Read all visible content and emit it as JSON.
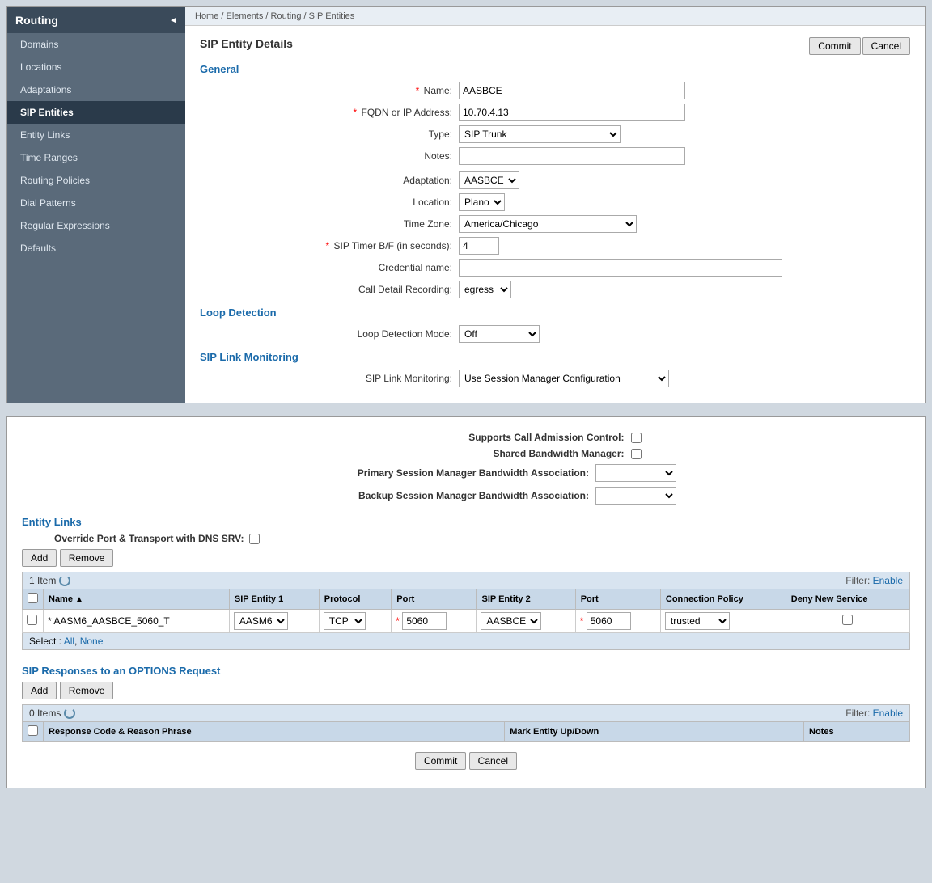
{
  "app": {
    "title": "Routing"
  },
  "breadcrumb": {
    "text": "Home / Elements / Routing / SIP Entities"
  },
  "sidebar": {
    "title": "Routing",
    "items": [
      {
        "label": "Domains",
        "active": false
      },
      {
        "label": "Locations",
        "active": false
      },
      {
        "label": "Adaptations",
        "active": false
      },
      {
        "label": "SIP Entities",
        "active": true
      },
      {
        "label": "Entity Links",
        "active": false
      },
      {
        "label": "Time Ranges",
        "active": false
      },
      {
        "label": "Routing Policies",
        "active": false
      },
      {
        "label": "Dial Patterns",
        "active": false
      },
      {
        "label": "Regular Expressions",
        "active": false
      },
      {
        "label": "Defaults",
        "active": false
      }
    ]
  },
  "form": {
    "title": "SIP Entity Details",
    "commit_btn": "Commit",
    "cancel_btn": "Cancel",
    "general_title": "General",
    "fields": {
      "name_label": "Name:",
      "name_value": "AASBCE",
      "fqdn_label": "FQDN or IP Address:",
      "fqdn_value": "10.70.4.13",
      "type_label": "Type:",
      "type_value": "SIP Trunk",
      "notes_label": "Notes:",
      "notes_value": "",
      "adaptation_label": "Adaptation:",
      "adaptation_value": "AASBCE",
      "location_label": "Location:",
      "location_value": "Plano",
      "timezone_label": "Time Zone:",
      "timezone_value": "America/Chicago",
      "sip_timer_label": "SIP Timer B/F (in seconds):",
      "sip_timer_value": "4",
      "credential_label": "Credential name:",
      "credential_value": "",
      "call_detail_label": "Call Detail Recording:",
      "call_detail_value": "egress"
    },
    "loop_detection_title": "Loop Detection",
    "loop_mode_label": "Loop Detection Mode:",
    "loop_mode_value": "Off",
    "sip_link_title": "SIP Link Monitoring",
    "sip_link_label": "SIP Link Monitoring:",
    "sip_link_value": "Use Session Manager Configuration"
  },
  "bandwidth": {
    "supports_cac_label": "Supports Call Admission Control:",
    "shared_bw_label": "Shared Bandwidth Manager:",
    "primary_sm_label": "Primary Session Manager Bandwidth Association:",
    "backup_sm_label": "Backup Session Manager Bandwidth Association:"
  },
  "entity_links": {
    "title": "Entity Links",
    "override_label": "Override Port & Transport with DNS SRV:",
    "add_btn": "Add",
    "remove_btn": "Remove",
    "item_count": "1 Item",
    "filter_label": "Filter:",
    "filter_link": "Enable",
    "columns": [
      "Name",
      "SIP Entity 1",
      "Protocol",
      "Port",
      "SIP Entity 2",
      "Port",
      "Connection Policy",
      "Deny New Service"
    ],
    "rows": [
      {
        "name": "* AASM6_AASBCE_5060_T",
        "sip_entity1": "AASM6",
        "protocol": "TCP",
        "port1": "* 5060",
        "sip_entity2": "AASBCE",
        "port2": "* 5060",
        "connection_policy": "trusted",
        "deny_new_service": false
      }
    ],
    "select_label": "Select :",
    "select_all": "All",
    "select_none": "None"
  },
  "sip_responses": {
    "title": "SIP Responses to an OPTIONS Request",
    "add_btn": "Add",
    "remove_btn": "Remove",
    "item_count": "0 Items",
    "filter_label": "Filter:",
    "filter_link": "Enable",
    "columns": [
      "Response Code & Reason Phrase",
      "Mark Entity Up/Down",
      "Notes"
    ]
  },
  "bottom_buttons": {
    "commit_btn": "Commit",
    "cancel_btn": "Cancel"
  }
}
